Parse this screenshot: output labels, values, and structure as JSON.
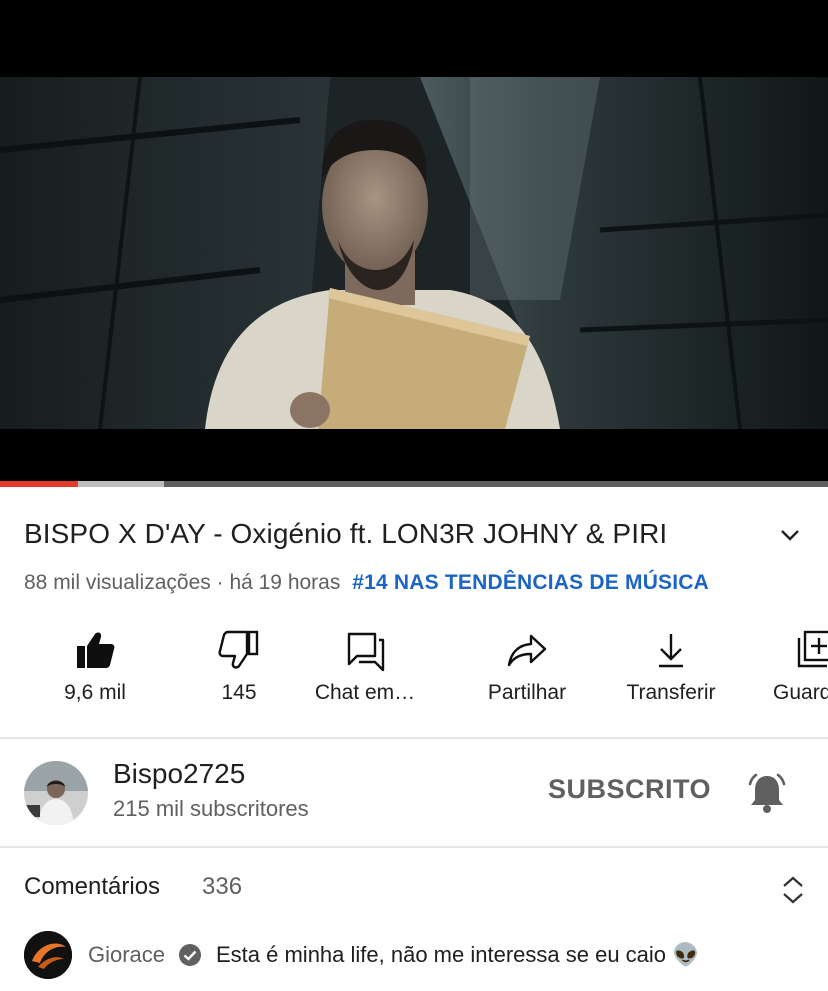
{
  "video": {
    "progress_played": 0.094,
    "progress_buffered": 0.198
  },
  "title": "BISPO X D'AY - Oxigénio ft. LON3R JOHNY & PIRI",
  "meta": {
    "views": "88 mil visualizações",
    "separator": "·",
    "time": "há 19 horas",
    "trending": "#14 NAS TENDÊNCIAS DE MÚSICA"
  },
  "actions": [
    {
      "label": "9,6 mil",
      "icon": "thumbs-up-icon"
    },
    {
      "label": "145",
      "icon": "thumbs-down-icon"
    },
    {
      "label": "Chat em…",
      "icon": "chat-icon"
    },
    {
      "label": "Partilhar",
      "icon": "share-icon"
    },
    {
      "label": "Transferir",
      "icon": "download-icon"
    },
    {
      "label": "Guardar",
      "icon": "save-icon"
    }
  ],
  "channel": {
    "name": "Bispo2725",
    "subscribers": "215 mil subscritores",
    "subscribe_label": "SUBSCRITO"
  },
  "comments": {
    "title": "Comentários",
    "count": "336",
    "first": {
      "author": "Giorace",
      "text": "Esta é minha life, não me interessa se eu caio 👽"
    }
  },
  "colors": {
    "accent_progress": "#e33a2c",
    "trending_link": "#1d64c7",
    "secondary_text": "#606060"
  }
}
